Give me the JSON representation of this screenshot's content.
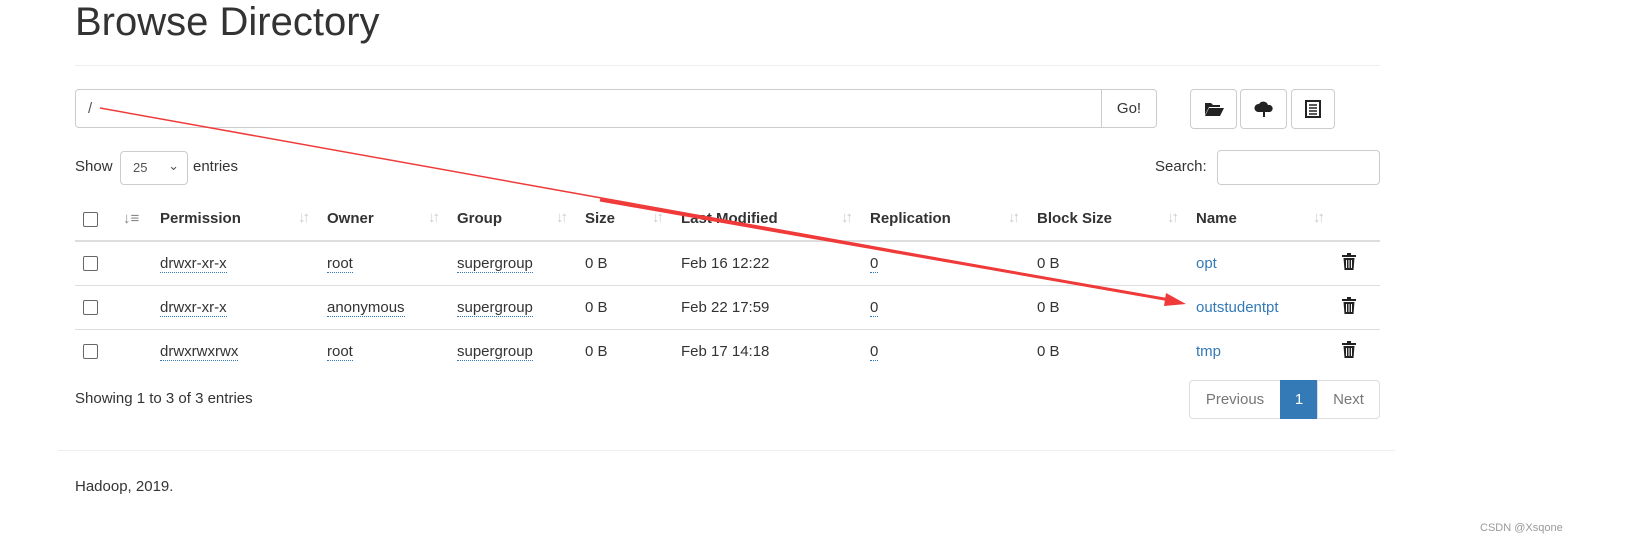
{
  "title": "Browse Directory",
  "path_input": {
    "value": "/"
  },
  "go_label": "Go!",
  "toolbar": {
    "icons": [
      "folder-open-icon",
      "cloud-upload-icon",
      "list-icon"
    ]
  },
  "length": {
    "show": "Show",
    "value": "25",
    "entries": "entries"
  },
  "search": {
    "label": "Search:",
    "value": ""
  },
  "columns": [
    "Permission",
    "Owner",
    "Group",
    "Size",
    "Last Modified",
    "Replication",
    "Block Size",
    "Name"
  ],
  "rows": [
    {
      "permission": "drwxr-xr-x",
      "owner": "root",
      "group": "supergroup",
      "size": "0 B",
      "modified": "Feb 16 12:22",
      "replication": "0",
      "block_size": "0 B",
      "name": "opt"
    },
    {
      "permission": "drwxr-xr-x",
      "owner": "anonymous",
      "group": "supergroup",
      "size": "0 B",
      "modified": "Feb 22 17:59",
      "replication": "0",
      "block_size": "0 B",
      "name": "outstudentpt"
    },
    {
      "permission": "drwxrwxrwx",
      "owner": "root",
      "group": "supergroup",
      "size": "0 B",
      "modified": "Feb 17 14:18",
      "replication": "0",
      "block_size": "0 B",
      "name": "tmp"
    }
  ],
  "info": "Showing 1 to 3 of 3 entries",
  "pagination": {
    "previous": "Previous",
    "current": "1",
    "next": "Next",
    "active_color": "#337ab7"
  },
  "footer": "Hadoop, 2019.",
  "watermark": "CSDN @Xsqone",
  "annotation_color": "#f03a3a"
}
